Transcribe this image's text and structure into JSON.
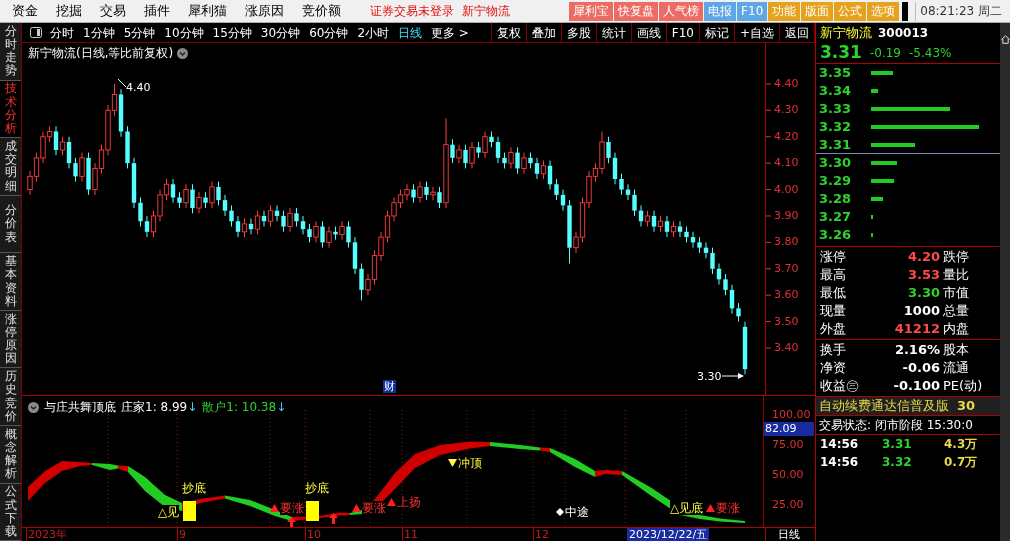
{
  "menu_bar": {
    "items": [
      "资金",
      "挖掘",
      "交易",
      "插件",
      "犀利猫",
      "涨原因",
      "竞价额"
    ],
    "notices": [
      "证券交易未登录",
      "新宁物流"
    ],
    "buttons": [
      {
        "label": "犀利宝",
        "color": "#ec6b64"
      },
      {
        "label": "快复盘",
        "color": "#ec6b64"
      },
      {
        "label": "人气榜",
        "color": "#ec6b64"
      },
      {
        "label": "电报",
        "color": "#5ea6e6"
      },
      {
        "label": "F10",
        "color": "#5ea6e6"
      },
      {
        "label": "功能",
        "color": "#e5a21f"
      },
      {
        "label": "版面",
        "color": "#e5a21f"
      },
      {
        "label": "公式",
        "color": "#e5a21f"
      },
      {
        "label": "选项",
        "color": "#e5a21f"
      }
    ],
    "clock": "08:21:23 周二"
  },
  "side_tabs": [
    {
      "label": "分时走势",
      "selected": false
    },
    {
      "label": "技术分析",
      "selected": true
    },
    {
      "label": "成交明细",
      "selected": false
    },
    {
      "label": "分价表",
      "selected": false
    },
    {
      "label": "基本资料",
      "selected": false
    },
    {
      "label": "涨停原因",
      "selected": false
    },
    {
      "label": "历史竞价",
      "selected": false
    },
    {
      "label": "概念解析",
      "selected": false
    },
    {
      "label": "公式下载",
      "selected": false
    }
  ],
  "period_tabs": [
    {
      "label": "分时",
      "selected": false
    },
    {
      "label": "1分钟",
      "selected": false
    },
    {
      "label": "5分钟",
      "selected": false
    },
    {
      "label": "10分钟",
      "selected": false
    },
    {
      "label": "15分钟",
      "selected": false
    },
    {
      "label": "30分钟",
      "selected": false
    },
    {
      "label": "60分钟",
      "selected": false
    },
    {
      "label": "2小时",
      "selected": false
    },
    {
      "label": "日线",
      "selected": true
    },
    {
      "label": "更多 >",
      "selected": false
    }
  ],
  "tools": [
    "复权",
    "叠加",
    "多股",
    "统计",
    "画线",
    "F10",
    "标记",
    "+自选",
    "返回"
  ],
  "chart": {
    "title": "新宁物流(日线,等比前复权)",
    "high_mark": "4.40",
    "low_mark": "3.30",
    "event_mark": "财",
    "chart_data": {
      "type": "candlestick",
      "ylim": [
        3.222,
        4.555
      ],
      "yticks": [
        {
          "value": 4.4,
          "label": "4.40"
        },
        {
          "value": 4.3,
          "label": "4.30"
        },
        {
          "value": 4.2,
          "label": "4.20"
        },
        {
          "value": 4.1,
          "label": "4.10"
        },
        {
          "value": 4.0,
          "label": "4.00"
        },
        {
          "value": 3.9,
          "label": "3.90"
        },
        {
          "value": 3.8,
          "label": "3.80"
        },
        {
          "value": 3.7,
          "label": "3.70"
        },
        {
          "value": 3.6,
          "label": "3.60"
        },
        {
          "value": 3.5,
          "label": "3.50"
        },
        {
          "value": 3.4,
          "label": "3.40"
        }
      ],
      "ohlc": [
        [
          4.0,
          4.07,
          3.98,
          4.05
        ],
        [
          4.05,
          4.14,
          4.03,
          4.12
        ],
        [
          4.12,
          4.22,
          4.1,
          4.2
        ],
        [
          4.2,
          4.24,
          4.18,
          4.22
        ],
        [
          4.22,
          4.24,
          4.13,
          4.15
        ],
        [
          4.15,
          4.2,
          4.13,
          4.18
        ],
        [
          4.18,
          4.2,
          4.08,
          4.1
        ],
        [
          4.1,
          4.12,
          4.03,
          4.05
        ],
        [
          4.05,
          4.14,
          4.03,
          4.12
        ],
        [
          4.12,
          4.14,
          3.98,
          4.0
        ],
        [
          4.0,
          4.1,
          3.98,
          4.08
        ],
        [
          4.08,
          4.17,
          4.06,
          4.15
        ],
        [
          4.15,
          4.32,
          4.13,
          4.3
        ],
        [
          4.3,
          4.4,
          4.28,
          4.36
        ],
        [
          4.36,
          4.38,
          4.2,
          4.22
        ],
        [
          4.22,
          4.24,
          4.08,
          4.1
        ],
        [
          4.1,
          4.12,
          3.93,
          3.95
        ],
        [
          3.95,
          3.97,
          3.86,
          3.88
        ],
        [
          3.88,
          3.9,
          3.82,
          3.84
        ],
        [
          3.84,
          3.92,
          3.82,
          3.9
        ],
        [
          3.9,
          4.0,
          3.88,
          3.98
        ],
        [
          3.98,
          4.04,
          3.96,
          4.02
        ],
        [
          4.02,
          4.04,
          3.95,
          3.97
        ],
        [
          3.97,
          3.99,
          3.93,
          3.95
        ],
        [
          3.95,
          4.02,
          3.93,
          4.0
        ],
        [
          4.0,
          4.02,
          3.91,
          3.93
        ],
        [
          3.93,
          3.99,
          3.91,
          3.97
        ],
        [
          3.97,
          3.99,
          3.93,
          3.95
        ],
        [
          3.95,
          4.03,
          3.93,
          4.01
        ],
        [
          4.01,
          4.03,
          3.94,
          3.96
        ],
        [
          3.96,
          3.98,
          3.9,
          3.92
        ],
        [
          3.92,
          3.94,
          3.86,
          3.88
        ],
        [
          3.88,
          3.9,
          3.82,
          3.84
        ],
        [
          3.84,
          3.89,
          3.82,
          3.87
        ],
        [
          3.87,
          3.89,
          3.83,
          3.85
        ],
        [
          3.85,
          3.92,
          3.83,
          3.9
        ],
        [
          3.9,
          3.92,
          3.86,
          3.88
        ],
        [
          3.88,
          3.94,
          3.86,
          3.92
        ],
        [
          3.92,
          3.94,
          3.88,
          3.9
        ],
        [
          3.9,
          3.92,
          3.84,
          3.86
        ],
        [
          3.86,
          3.93,
          3.84,
          3.91
        ],
        [
          3.91,
          3.93,
          3.86,
          3.88
        ],
        [
          3.88,
          3.9,
          3.83,
          3.85
        ],
        [
          3.85,
          3.87,
          3.8,
          3.82
        ],
        [
          3.82,
          3.88,
          3.8,
          3.86
        ],
        [
          3.86,
          3.88,
          3.78,
          3.8
        ],
        [
          3.8,
          3.86,
          3.78,
          3.84
        ],
        [
          3.84,
          3.86,
          3.81,
          3.83
        ],
        [
          3.83,
          3.88,
          3.81,
          3.86
        ],
        [
          3.86,
          3.88,
          3.78,
          3.8
        ],
        [
          3.8,
          3.82,
          3.68,
          3.7
        ],
        [
          3.7,
          3.72,
          3.58,
          3.62
        ],
        [
          3.62,
          3.68,
          3.6,
          3.66
        ],
        [
          3.66,
          3.77,
          3.64,
          3.75
        ],
        [
          3.75,
          3.84,
          3.73,
          3.82
        ],
        [
          3.82,
          3.92,
          3.8,
          3.9
        ],
        [
          3.9,
          3.97,
          3.88,
          3.95
        ],
        [
          3.95,
          4.0,
          3.93,
          3.98
        ],
        [
          3.98,
          4.02,
          3.96,
          4.0
        ],
        [
          4.0,
          4.02,
          3.95,
          3.97
        ],
        [
          3.97,
          4.03,
          3.95,
          4.01
        ],
        [
          4.01,
          4.03,
          3.96,
          3.98
        ],
        [
          3.98,
          4.01,
          3.96,
          3.99
        ],
        [
          3.99,
          4.01,
          3.93,
          3.95
        ],
        [
          3.95,
          4.27,
          3.93,
          4.17
        ],
        [
          4.17,
          4.19,
          4.1,
          4.12
        ],
        [
          4.12,
          4.17,
          4.1,
          4.15
        ],
        [
          4.15,
          4.17,
          4.08,
          4.1
        ],
        [
          4.1,
          4.18,
          4.08,
          4.16
        ],
        [
          4.16,
          4.18,
          4.12,
          4.14
        ],
        [
          4.14,
          4.22,
          4.12,
          4.2
        ],
        [
          4.2,
          4.22,
          4.16,
          4.18
        ],
        [
          4.18,
          4.2,
          4.1,
          4.12
        ],
        [
          4.12,
          4.14,
          4.08,
          4.1
        ],
        [
          4.1,
          4.16,
          4.08,
          4.14
        ],
        [
          4.14,
          4.16,
          4.06,
          4.08
        ],
        [
          4.08,
          4.14,
          4.06,
          4.12
        ],
        [
          4.12,
          4.14,
          4.08,
          4.1
        ],
        [
          4.1,
          4.12,
          4.04,
          4.06
        ],
        [
          4.06,
          4.11,
          4.04,
          4.09
        ],
        [
          4.09,
          4.11,
          4.0,
          4.02
        ],
        [
          4.02,
          4.04,
          3.96,
          3.98
        ],
        [
          3.98,
          4.0,
          3.92,
          3.94
        ],
        [
          3.94,
          3.96,
          3.72,
          3.78
        ],
        [
          3.78,
          3.84,
          3.76,
          3.82
        ],
        [
          3.82,
          3.97,
          3.8,
          3.95
        ],
        [
          3.95,
          4.07,
          3.93,
          4.05
        ],
        [
          4.05,
          4.1,
          4.03,
          4.08
        ],
        [
          4.08,
          4.22,
          4.06,
          4.18
        ],
        [
          4.18,
          4.2,
          4.1,
          4.12
        ],
        [
          4.12,
          4.14,
          4.02,
          4.04
        ],
        [
          4.04,
          4.06,
          3.98,
          4.0
        ],
        [
          4.0,
          4.02,
          3.96,
          3.98
        ],
        [
          3.98,
          4.0,
          3.9,
          3.92
        ],
        [
          3.92,
          3.94,
          3.86,
          3.88
        ],
        [
          3.88,
          3.92,
          3.86,
          3.9
        ],
        [
          3.9,
          3.92,
          3.84,
          3.86
        ],
        [
          3.86,
          3.9,
          3.84,
          3.88
        ],
        [
          3.88,
          3.9,
          3.82,
          3.84
        ],
        [
          3.84,
          3.88,
          3.82,
          3.86
        ],
        [
          3.86,
          3.88,
          3.82,
          3.84
        ],
        [
          3.84,
          3.86,
          3.8,
          3.82
        ],
        [
          3.82,
          3.84,
          3.78,
          3.8
        ],
        [
          3.8,
          3.82,
          3.76,
          3.78
        ],
        [
          3.78,
          3.8,
          3.74,
          3.76
        ],
        [
          3.76,
          3.78,
          3.68,
          3.7
        ],
        [
          3.7,
          3.72,
          3.64,
          3.66
        ],
        [
          3.66,
          3.68,
          3.6,
          3.62
        ],
        [
          3.62,
          3.64,
          3.53,
          3.55
        ],
        [
          3.55,
          3.57,
          3.5,
          3.52
        ],
        [
          3.48,
          3.5,
          3.3,
          3.32
        ]
      ]
    }
  },
  "indicator": {
    "name": "与庄共舞顶底",
    "lines": [
      {
        "label": "庄家1: 8.99",
        "arrow": "↓",
        "color": "#ffffff"
      },
      {
        "label": "散户1: 10.38",
        "arrow": "↓",
        "color": "#2fd12f"
      }
    ],
    "axis": [
      "100.00",
      "75.00",
      "50.00",
      "25.00"
    ],
    "current": "82.09",
    "signals": [
      {
        "kind": "bottom",
        "text": "△见"
      },
      {
        "kind": "buy",
        "text": "抄底"
      },
      {
        "kind": "rise",
        "text": "要涨"
      },
      {
        "kind": "buy",
        "text": "抄底"
      },
      {
        "kind": "rise",
        "text": "要涨"
      },
      {
        "kind": "rise",
        "text": "上扬"
      },
      {
        "kind": "top",
        "text": "冲顶"
      },
      {
        "kind": "mid",
        "text": "中途"
      },
      {
        "kind": "bottom",
        "text": "△见底"
      },
      {
        "kind": "rise",
        "text": "要涨"
      }
    ]
  },
  "date_axis": {
    "labels": [
      "2023年",
      "9",
      "10",
      "11",
      "12"
    ],
    "cursor_date": "2023/12/22/五",
    "period": "日线"
  },
  "quote": {
    "name": "新宁物流",
    "code": "300013",
    "price": "3.31",
    "change": "-0.19",
    "change_pct": "-5.43%",
    "order_book": [
      {
        "price": "3.35"
      },
      {
        "price": "3.34"
      },
      {
        "price": "3.33"
      },
      {
        "price": "3.32"
      },
      {
        "price": "3.31"
      },
      {
        "price": "3.30"
      },
      {
        "price": "3.29"
      },
      {
        "price": "3.28"
      },
      {
        "price": "3.27"
      },
      {
        "price": "3.26"
      }
    ],
    "stats": [
      {
        "label": "涨停",
        "value": "4.20",
        "color": "#ff4a4a",
        "label2": "跌停"
      },
      {
        "label": "最高",
        "value": "3.53",
        "color": "#ff4a4a",
        "label2": "量比"
      },
      {
        "label": "最低",
        "value": "3.30",
        "color": "#2fd12f",
        "label2": "市值"
      },
      {
        "label": "现量",
        "value": "1000",
        "color": "#ffffff",
        "label2": "总量"
      },
      {
        "label": "外盘",
        "value": "41212",
        "color": "#ff4a4a",
        "label2": "内盘"
      }
    ],
    "stats2": [
      {
        "label": "换手",
        "value": "2.16%",
        "color": "#ffffff",
        "label2": "股本"
      },
      {
        "label": "净资",
        "value": "-0.06",
        "color": "#ffffff",
        "label2": "流通"
      },
      {
        "label": "收益㊂",
        "value": "-0.100",
        "color": "#ffffff",
        "label2": "PE(动)"
      }
    ],
    "banner": {
      "text": "自动续费通达信普及版",
      "extra": "30"
    },
    "status": "交易状态: 闭市阶段 15:30:0",
    "ticks": [
      {
        "time": "14:56",
        "price": "3.31",
        "volume": "4.3万"
      },
      {
        "time": "14:56",
        "price": "3.32",
        "volume": "0.7万"
      }
    ]
  }
}
